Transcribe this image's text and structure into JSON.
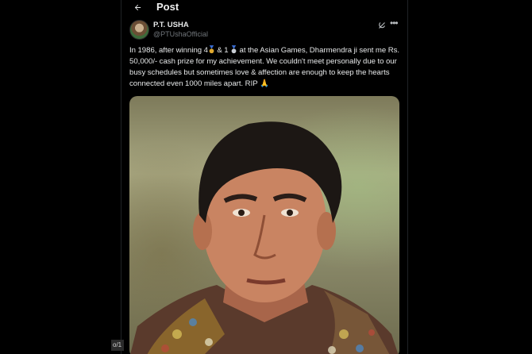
{
  "header": {
    "title": "Post"
  },
  "author": {
    "name": "P.T. USHA",
    "handle": "@PTUshaOfficial"
  },
  "tweet": {
    "part1": "In 1986, after winning 4",
    "part2": " & 1 ",
    "part3": " at the Asian Games, Dharmendra ji sent me Rs. 50,000/- cash prize for my achievement. We couldn't meet personally due to our busy schedules but sometimes love & affection are enough to keep the hearts connected even 1000 miles apart. RIP ",
    "emoji_end": "🙏"
  },
  "media": {
    "counter": "o/1"
  },
  "colors": {
    "background": "#000000",
    "text": "#e7e9ea",
    "muted": "#71767b",
    "gold": "#e0a82e",
    "silver": "#c8cdd3"
  },
  "icons": [
    "back-arrow-icon",
    "grok-icon",
    "more-icon",
    "gold-medal-icon",
    "silver-medal-icon",
    "folded-hands-icon"
  ]
}
